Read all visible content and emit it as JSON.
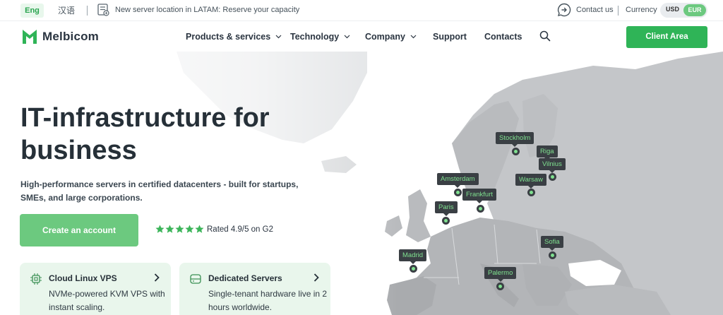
{
  "topbar": {
    "lang_active": "Eng",
    "lang_alt": "汉语",
    "notice": "New server location in LATAM: Reserve your capacity",
    "contact_us": "Contact us",
    "currency_label": "Currency",
    "currency_usd": "USD",
    "currency_eur": "EUR"
  },
  "nav": {
    "brand": "Melbicom",
    "items": [
      "Products & services",
      "Technology",
      "Company",
      "Support",
      "Contacts"
    ],
    "client_area": "Client Area"
  },
  "hero": {
    "title": "IT-infrastructure for business",
    "subtitle": "High-performance servers in certified datacenters - built for startups, SMEs, and large corporations.",
    "cta": "Create an account",
    "rating": "Rated 4.9/5 on G2",
    "stars": 5
  },
  "cards": [
    {
      "title": "Cloud Linux VPS",
      "desc": "NVMe-powered KVM VPS with instant scaling.",
      "icon": "chip-icon"
    },
    {
      "title": "Dedicated Servers",
      "desc": "Single-tenant hardware live in 2 hours worldwide.",
      "icon": "server-icon"
    }
  ],
  "map": {
    "cities": [
      "Stockholm",
      "Riga",
      "Vilnius",
      "Amsterdam",
      "Warsaw",
      "Frankfurt",
      "Paris",
      "Sofia",
      "Madrid",
      "Palermo"
    ]
  },
  "colors": {
    "accent": "#2fb457",
    "accent_light": "#6cc97f",
    "card_bg": "#e9f6ec",
    "label_bg": "#3a3f44",
    "label_text": "#7fe08f"
  }
}
